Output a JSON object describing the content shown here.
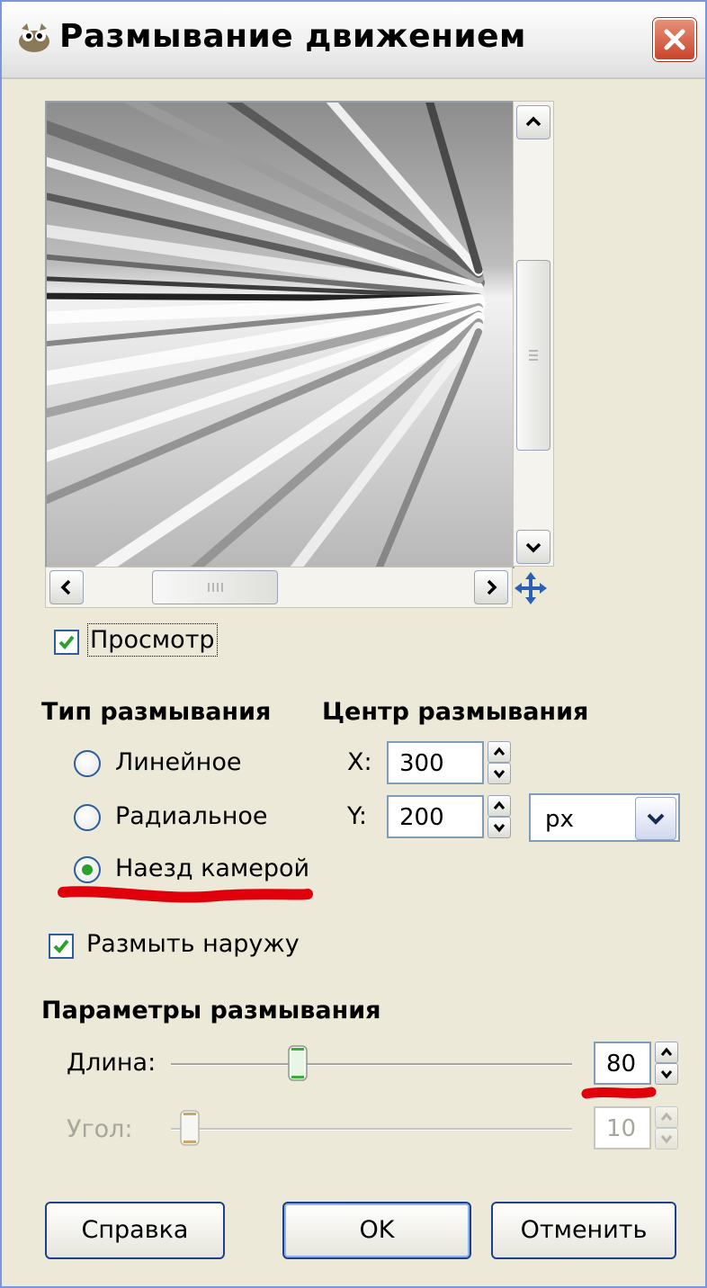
{
  "window": {
    "title": "Размывание движением"
  },
  "preview": {
    "label": "Просмотр",
    "checked": true
  },
  "blur_type": {
    "heading": "Тип размывания",
    "options": [
      {
        "label": "Линейное",
        "selected": false
      },
      {
        "label": "Радиальное",
        "selected": false
      },
      {
        "label": "Наезд камерой",
        "selected": true
      }
    ]
  },
  "blur_center": {
    "heading": "Центр размывания",
    "x_label": "X:",
    "x_value": "300",
    "y_label": "Y:",
    "y_value": "200",
    "unit": "px"
  },
  "blur_outward": {
    "label": "Размыть наружу",
    "checked": true
  },
  "blur_params": {
    "heading": "Параметры размывания",
    "length_label": "Длина:",
    "length_value": "80",
    "angle_label": "Угол:",
    "angle_value": "10",
    "angle_enabled": false
  },
  "buttons": {
    "help": "Справка",
    "ok": "OK",
    "cancel": "Отменить"
  },
  "colors": {
    "accent_green": "#2aa12a",
    "annotation_red": "#e0000c",
    "close_red": "#c9442a"
  },
  "icons": [
    "gimp-app-icon",
    "close-icon",
    "navigate-move-icon",
    "check-icon",
    "chevron-up-icon",
    "chevron-down-icon",
    "chevron-left-icon",
    "chevron-right-icon"
  ]
}
